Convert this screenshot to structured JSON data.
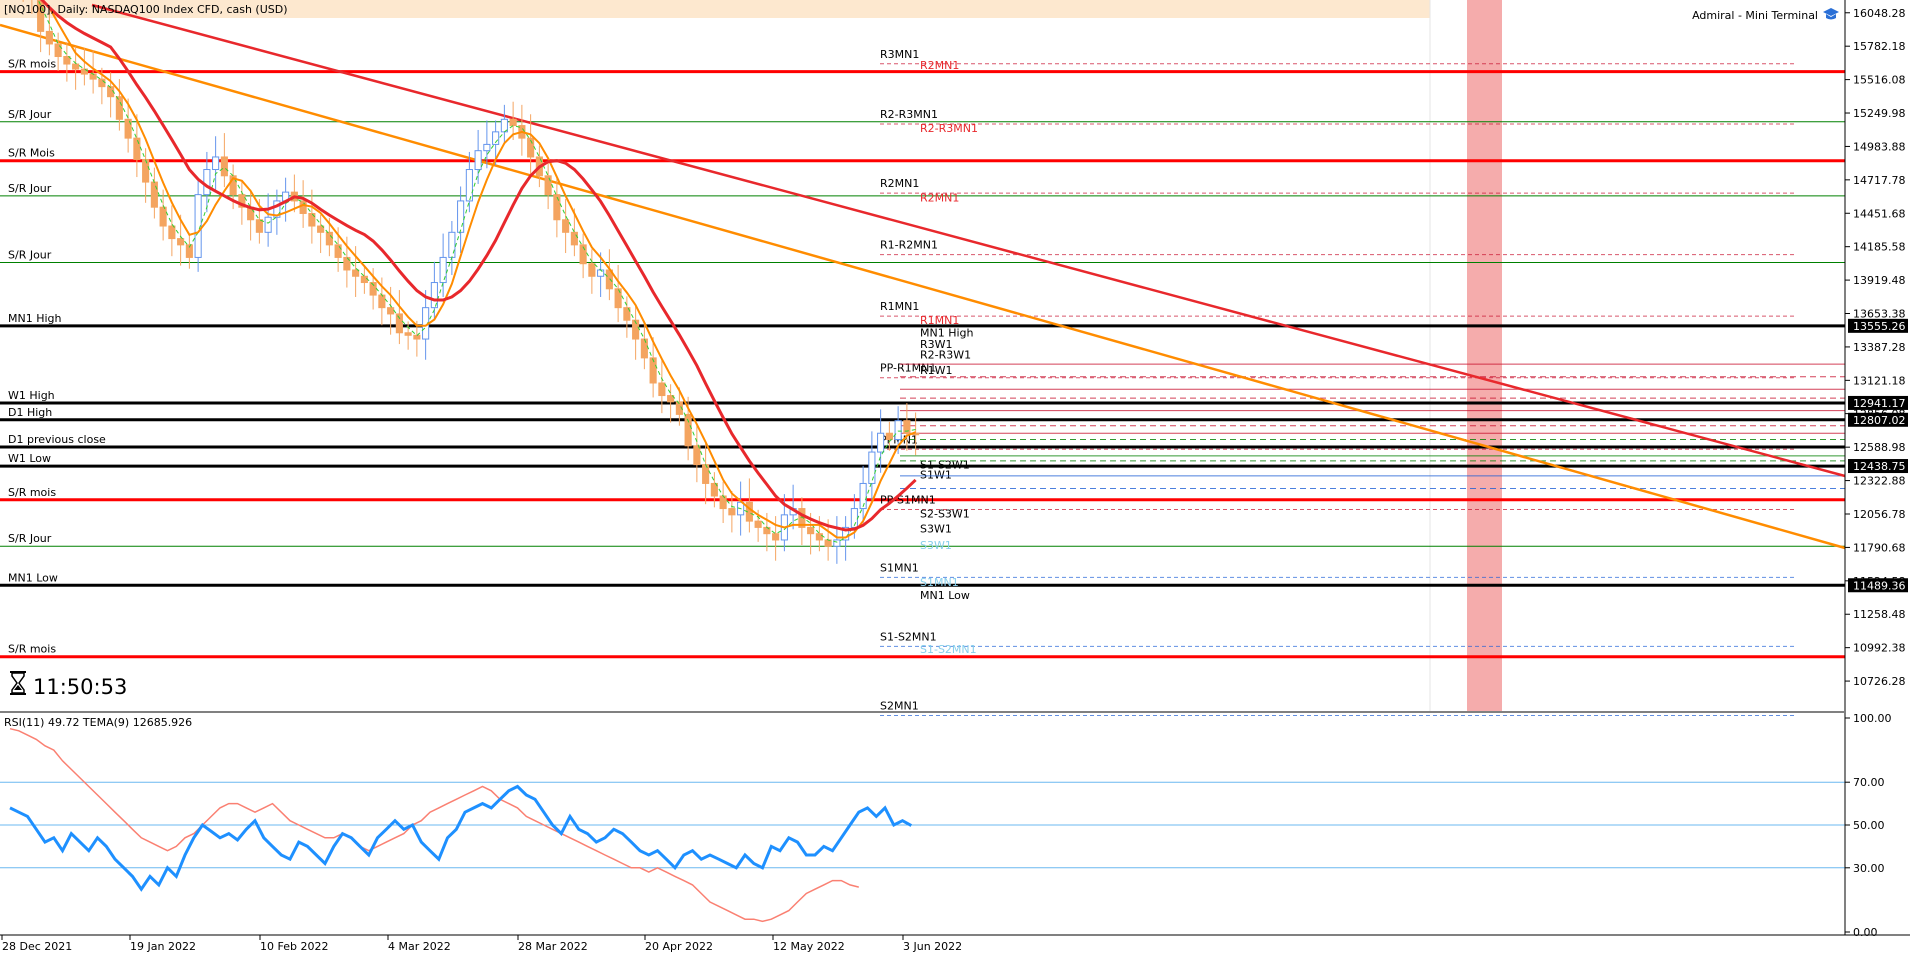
{
  "window": {
    "symbol_info": "[NQ100], Daily: NASDAQ100 Index CFD, cash (USD)",
    "terminal_name": "Admiral - Mini Terminal",
    "terminal_icon": "graduation-cap-icon",
    "countdown": "11:50:53",
    "countdown_icon": "hourglass-icon"
  },
  "colors": {
    "background": "#ffffff",
    "bull_candle": "#6495ed",
    "bear_candle": "#f4a460",
    "sr_red": "#ff0000",
    "sr_green": "#008000",
    "mn1_black": "#000000",
    "orange_trend": "#ff8c00",
    "red_trend": "#e8282c",
    "rsi_line": "#1e90ff",
    "tema_line": "#fa8072",
    "highlight_band": "#f08080"
  },
  "price_axis": {
    "ticks": [
      "16048.28",
      "15782.18",
      "15516.08",
      "15249.98",
      "14983.88",
      "14717.78",
      "14451.68",
      "14185.58",
      "13919.48",
      "13653.38",
      "13387.28",
      "13121.18",
      "12856.08",
      "12588.98",
      "12322.88",
      "12056.78",
      "11790.68",
      "11524.58",
      "11258.48",
      "10992.38",
      "10726.28"
    ],
    "tags": [
      {
        "label": "13555.26",
        "price": 13555.26
      },
      {
        "label": "12941.17",
        "price": 12941.17
      },
      {
        "label": "12807.02",
        "price": 12807.02
      },
      {
        "label": "12438.75",
        "price": 12438.75
      },
      {
        "label": "11489.36",
        "price": 11489.36
      }
    ]
  },
  "date_axis": [
    "28 Dec 2021",
    "19 Jan 2022",
    "10 Feb 2022",
    "4 Mar 2022",
    "28 Mar 2022",
    "20 Apr 2022",
    "12 May 2022",
    "3 Jun 2022"
  ],
  "levels": [
    {
      "label": "S/R mois",
      "price": 15580,
      "kind": "sr-red"
    },
    {
      "label": "S/R Jour",
      "price": 15180,
      "kind": "sr-green"
    },
    {
      "label": "S/R Mois",
      "price": 14870,
      "kind": "sr-red"
    },
    {
      "label": "S/R Jour",
      "price": 14590,
      "kind": "sr-green"
    },
    {
      "label": "S/R Jour",
      "price": 14060,
      "kind": "sr-green"
    },
    {
      "label": "MN1 High",
      "price": 13555,
      "kind": "black"
    },
    {
      "label": "W1 High",
      "price": 12941,
      "kind": "black"
    },
    {
      "label": "D1 High",
      "price": 12807,
      "kind": "black"
    },
    {
      "label": "D1 previous close",
      "price": 12590,
      "kind": "black"
    },
    {
      "label": "W1 Low",
      "price": 12438,
      "kind": "black"
    },
    {
      "label": "S/R mois",
      "price": 12170,
      "kind": "sr-red"
    },
    {
      "label": "S/R Jour",
      "price": 11800,
      "kind": "sr-green"
    },
    {
      "label": "MN1 Low",
      "price": 11489,
      "kind": "black"
    },
    {
      "label": "S/R mois",
      "price": 10920,
      "kind": "sr-red"
    }
  ],
  "pivot_labels": [
    {
      "label": "R3MN1",
      "price": 15690
    },
    {
      "label": "R2MN1",
      "price": 15600,
      "faint": true
    },
    {
      "label": "R2-R3MN1",
      "price": 15210
    },
    {
      "label": "R2-R3MN1",
      "price": 15100,
      "faint": true
    },
    {
      "label": "R2MN1",
      "price": 14660
    },
    {
      "label": "R2MN1",
      "price": 14545,
      "faint": true
    },
    {
      "label": "R1-R2MN1",
      "price": 14170
    },
    {
      "label": "R1MN1",
      "price": 13680
    },
    {
      "label": "R1MN1",
      "price": 13570,
      "faint": true
    },
    {
      "label": "MN1 High",
      "price": 13470,
      "offset": true
    },
    {
      "label": "R3W1",
      "price": 13380,
      "offset": true
    },
    {
      "label": "R2-R3W1",
      "price": 13295,
      "offset": true
    },
    {
      "label": "PP-R1MN1",
      "price": 13190
    },
    {
      "label": "R1W1",
      "price": 13170,
      "offset": true
    },
    {
      "label": "PPMN1",
      "price": 12620
    },
    {
      "label": "S1-S2W1",
      "price": 12420,
      "offset": true
    },
    {
      "label": "S1W1",
      "price": 12340,
      "offset": true
    },
    {
      "label": "PP-S1MN1",
      "price": 12140
    },
    {
      "label": "S2-S3W1",
      "price": 12030,
      "offset": true
    },
    {
      "label": "S3W1",
      "price": 11910,
      "offset": true
    },
    {
      "label": "S3W1",
      "price": 11780,
      "faint": true,
      "offset": true
    },
    {
      "label": "S1MN1",
      "price": 11600
    },
    {
      "label": "S1MN1",
      "price": 11485,
      "faint": true
    },
    {
      "label": "MN1 Low",
      "price": 11380,
      "offset": true
    },
    {
      "label": "S1-S2MN1",
      "price": 11050
    },
    {
      "label": "S1-S2MN1",
      "price": 10950,
      "faint": true
    },
    {
      "label": "S2MN1",
      "price": 10500
    }
  ],
  "rsi": {
    "header": "RSI(11) 49.72 TEMA(9) 12685.926",
    "ticks": [
      "100.00",
      "70.00",
      "50.00",
      "30.00",
      "0.00"
    ],
    "levels": [
      70,
      50,
      30
    ],
    "rsi_values": [
      58,
      56,
      54,
      48,
      42,
      44,
      38,
      46,
      42,
      38,
      44,
      40,
      34,
      30,
      26,
      20,
      26,
      22,
      30,
      26,
      36,
      44,
      50,
      47,
      44,
      46,
      43,
      48,
      52,
      44,
      40,
      36,
      34,
      42,
      40,
      36,
      32,
      40,
      46,
      44,
      40,
      36,
      44,
      48,
      52,
      48,
      50,
      42,
      38,
      34,
      44,
      48,
      56,
      58,
      60,
      58,
      62,
      66,
      68,
      64,
      62,
      56,
      50,
      46,
      54,
      48,
      46,
      42,
      44,
      48,
      46,
      42,
      38,
      36,
      38,
      34,
      30,
      36,
      38,
      34,
      36,
      34,
      32,
      30,
      36,
      32,
      30,
      40,
      38,
      44,
      42,
      36,
      36,
      40,
      38,
      44,
      50,
      56,
      58,
      54,
      58,
      50,
      52,
      49.72
    ],
    "tema_values": [
      95,
      94,
      92,
      90,
      87,
      85,
      80,
      76,
      72,
      68,
      64,
      60,
      56,
      52,
      48,
      44,
      42,
      40,
      38,
      40,
      44,
      46,
      50,
      54,
      58,
      60,
      60,
      58,
      56,
      58,
      60,
      56,
      52,
      50,
      48,
      46,
      44,
      44,
      46,
      44,
      40,
      38,
      40,
      42,
      44,
      46,
      50,
      52,
      56,
      58,
      60,
      62,
      64,
      66,
      68,
      66,
      62,
      60,
      58,
      54,
      52,
      50,
      48,
      46,
      44,
      42,
      40,
      38,
      36,
      34,
      32,
      30,
      30,
      28,
      30,
      28,
      26,
      24,
      22,
      18,
      14,
      12,
      10,
      8,
      6,
      6,
      5,
      6,
      8,
      10,
      14,
      18,
      20,
      22,
      24,
      24,
      22,
      21
    ]
  },
  "chart_data": {
    "type": "candlestick",
    "title": "[NQ100], Daily: NASDAQ100 Index CFD, cash (USD)",
    "x_range": [
      "28 Dec 2021",
      "3 Jun 2022"
    ],
    "y_range": [
      10480,
      16150
    ],
    "grid": false,
    "close": [
      16320,
      16250,
      16180,
      15900,
      15800,
      15700,
      15640,
      15600,
      15560,
      15520,
      15460,
      15380,
      15200,
      15050,
      14880,
      14700,
      14500,
      14350,
      14250,
      14200,
      14100,
      14600,
      14800,
      14900,
      14750,
      14600,
      14500,
      14400,
      14300,
      14420,
      14550,
      14620,
      14550,
      14450,
      14350,
      14300,
      14200,
      14100,
      14000,
      13950,
      13900,
      13800,
      13700,
      13650,
      13500,
      13480,
      13450,
      13700,
      13900,
      14100,
      14300,
      14550,
      14800,
      14950,
      15000,
      15100,
      15200,
      15150,
      15050,
      14900,
      14750,
      14600,
      14400,
      14300,
      14200,
      14050,
      13950,
      14000,
      13850,
      13700,
      13600,
      13450,
      13300,
      13100,
      13000,
      12950,
      12850,
      12600,
      12450,
      12300,
      12200,
      12100,
      12050,
      12150,
      12000,
      11950,
      11900,
      11850,
      12050,
      12100,
      11950,
      11900,
      11850,
      11800,
      11850,
      11950,
      12100,
      12300,
      12550,
      12700,
      12650,
      12800,
      12700,
      12690
    ],
    "series": [
      {
        "name": "RSI(11)",
        "latest": 49.72
      },
      {
        "name": "TEMA(9)",
        "latest": 12685.926
      }
    ]
  }
}
